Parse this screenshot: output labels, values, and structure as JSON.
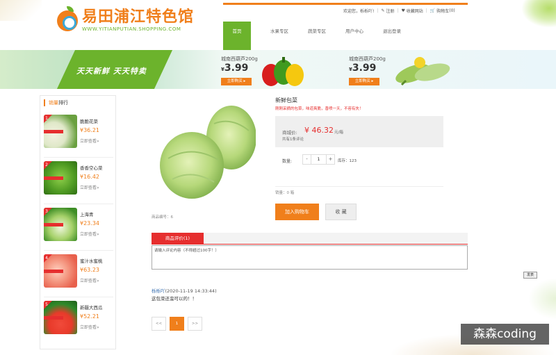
{
  "header": {
    "logo_cn": "易田浦江特色馆",
    "logo_en": "WWW.YITIANPUTIAN.SHOPPING.COM",
    "toplinks": {
      "welcome": "欢迎您，",
      "username": "栎栎吖!",
      "register": "注册",
      "favorite": "收藏网站",
      "cart": "购物车",
      "cart_count": "(0)"
    },
    "nav": [
      {
        "label": "首页"
      },
      {
        "label": "水果专区"
      },
      {
        "label": "蔬菜专区"
      },
      {
        "label": "用户中心"
      },
      {
        "label": "退出登录"
      }
    ]
  },
  "banner": {
    "slogan": "天天新鲜  天天特卖",
    "promos": [
      {
        "name": "城南西葫芦200g",
        "currency": "¥",
        "price": "3.99",
        "button": "立即购买 ▸"
      },
      {
        "name": "城南西葫芦200g",
        "currency": "¥",
        "price": "3.99",
        "button": "立即购买 ▸"
      }
    ]
  },
  "sidebar": {
    "title_highlight": "销量",
    "title_rest": "排行",
    "items": [
      {
        "rank": "1",
        "name": "脆脆花菜",
        "price": "¥36.21",
        "link": "立即查看»"
      },
      {
        "rank": "2",
        "name": "香香空心菜",
        "price": "¥16.42",
        "link": "立即查看»"
      },
      {
        "rank": "3",
        "name": "上海青",
        "price": "¥23.34",
        "link": "立即查看»"
      },
      {
        "rank": "4",
        "name": "蜜汁水蜜桃",
        "price": "¥63.23",
        "link": "立即查看»"
      },
      {
        "rank": "5",
        "name": "新疆大西瓜",
        "price": "¥52.21",
        "link": "立即查看»"
      }
    ]
  },
  "product": {
    "title": "新鲜包菜",
    "subtitle": "刚刚采摘的包菜，味道爽脆，香喷一天，不容有失！",
    "number": "商品编号：6",
    "price_label": "商城价:",
    "price": "¥ 46.32",
    "unit": "元/箱",
    "review_count": "共有1条评论",
    "qty_label": "数量:",
    "qty_minus": "-",
    "qty_value": "1",
    "qty_plus": "+",
    "stock": "库存：123",
    "sales": "销量：0  箱",
    "add_to_cart": "加入购物车",
    "favorite": "收 藏"
  },
  "reviews": {
    "tab": "商品评价(1)",
    "placeholder": "请输入评论内容（不得超过100字！）",
    "submit": "发表",
    "user": "栎栎吖",
    "time": "(2020-11-19 14:33:44)",
    "text": "这包菜还蛮可以的！！"
  },
  "pager": {
    "prev": "<<",
    "current": "1",
    "next": ">>"
  },
  "watermark": "森森coding",
  "colors": {
    "orange": "#f07f1b",
    "green": "#6cb32c",
    "red": "#e62e2e"
  }
}
